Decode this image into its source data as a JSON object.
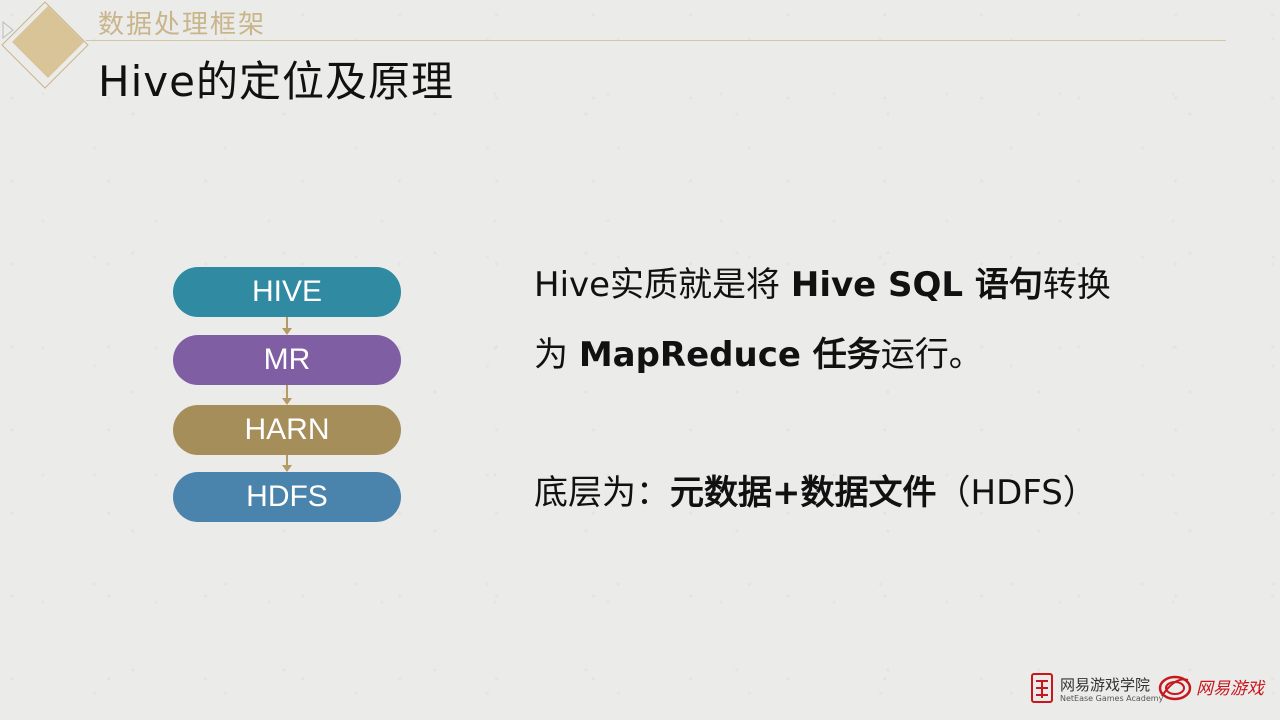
{
  "header": {
    "section_title": "数据处理框架",
    "page_title": "Hive的定位及原理"
  },
  "flow": {
    "steps": [
      {
        "label": "HIVE",
        "color": "#2f8aa2"
      },
      {
        "label": "MR",
        "color": "#7f5ea3"
      },
      {
        "label": "HARN",
        "color": "#a68e5b"
      },
      {
        "label": "HDFS",
        "color": "#4a83ab"
      }
    ],
    "arrow_color": "#b49a66"
  },
  "content": {
    "para1": {
      "line1_prefix": "Hive实质就是将 ",
      "line1_bold": "Hive SQL 语句",
      "line1_suffix": "转换",
      "line2_prefix": "为 ",
      "line2_bold": "MapReduce 任务",
      "line2_suffix": "运行。"
    },
    "para2": {
      "prefix": "底层为：",
      "bold": "元数据+数据文件",
      "suffix": "（HDFS）"
    }
  },
  "branding": {
    "academy_name": "网易游戏学院",
    "academy_sub": "NetEase Games Academy",
    "games_name": "网易游戏",
    "accent_color": "#c8161d"
  },
  "colors": {
    "gold": "#c9b58a",
    "background": "#ebebea"
  }
}
